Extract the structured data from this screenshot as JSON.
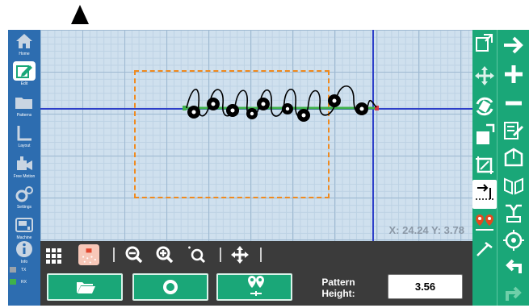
{
  "sidebar": {
    "items": [
      {
        "label": "Home",
        "icon": "home-icon"
      },
      {
        "label": "Edit",
        "icon": "edit-icon",
        "active": true
      },
      {
        "label": "Patterns",
        "icon": "folder-icon"
      },
      {
        "label": "Layout",
        "icon": "layout-icon"
      },
      {
        "label": "Free Motion",
        "icon": "free-motion-icon"
      },
      {
        "label": "Settings",
        "icon": "gear-icon"
      },
      {
        "label": "Machine",
        "icon": "machine-icon"
      },
      {
        "label": "Info",
        "icon": "info-icon"
      }
    ],
    "legend": [
      {
        "label": "TX",
        "color": "#9aa3ab"
      },
      {
        "label": "RX",
        "color": "#3fb24a"
      }
    ]
  },
  "canvas": {
    "coords_text": "X:  24.24 Y:  3.78",
    "grid_color": "#cfe0ee",
    "crosshair_color": "#2d3fc9",
    "boundary_color": "#f08a1e"
  },
  "toolbar": {
    "tools": [
      "grid-icon",
      "stitch-preview-icon",
      "zoom-out-icon",
      "zoom-in-icon",
      "zoom-fit-icon",
      "pan-icon"
    ],
    "buttons": [
      "open-folder-icon",
      "center-icon",
      "set-points-icon"
    ],
    "pattern_height_label": "Pattern Height:",
    "pattern_height_value": "3.56"
  },
  "right_tools": [
    "move-corner-icon",
    "move-icon",
    "rotate-icon",
    "resize-icon",
    "crop-icon",
    "align-icon",
    "points-icon",
    "needle-icon"
  ],
  "right_actions": [
    "arrow-right-icon",
    "plus-icon",
    "minus-icon",
    "edit-list-icon",
    "box-icon",
    "repeat-icon",
    "merge-icon",
    "undo-icon",
    "redo-icon"
  ],
  "colors": {
    "sidebar": "#2d6db0",
    "accent": "#1aa778",
    "toolbar": "#3b3b3b"
  }
}
